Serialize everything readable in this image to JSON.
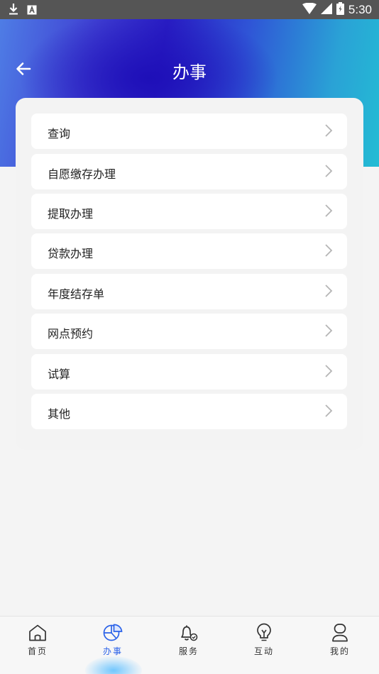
{
  "status_bar": {
    "time": "5:30"
  },
  "header": {
    "title": "办事"
  },
  "menu": {
    "items": [
      {
        "label": "查询"
      },
      {
        "label": "自愿缴存办理"
      },
      {
        "label": "提取办理"
      },
      {
        "label": "贷款办理"
      },
      {
        "label": "年度结存单"
      },
      {
        "label": "网点预约"
      },
      {
        "label": "试算"
      },
      {
        "label": "其他"
      }
    ]
  },
  "tabbar": {
    "tabs": [
      {
        "label": "首页",
        "icon": "home-icon"
      },
      {
        "label": "办事",
        "icon": "pie-chart-icon",
        "active": true
      },
      {
        "label": "服务",
        "icon": "bell-icon"
      },
      {
        "label": "互动",
        "icon": "lightbulb-icon"
      },
      {
        "label": "我的",
        "icon": "user-icon"
      }
    ]
  },
  "colors": {
    "accent": "#2b62e8",
    "status_bar": "#555555",
    "background": "#f4f4f4"
  }
}
